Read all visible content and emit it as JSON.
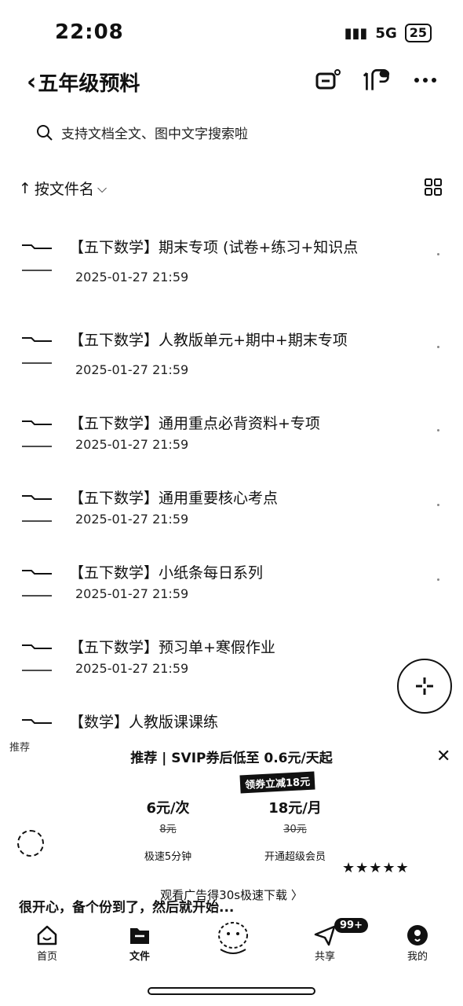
{
  "status_bar": {
    "time": "22:08",
    "network": "5G",
    "battery": "25"
  },
  "nav": {
    "title": "五年级预料"
  },
  "search": {
    "placeholder": "支持文档全文、图中文字搜索啦"
  },
  "sort": {
    "label": "按文件名"
  },
  "files": [
    {
      "name": "【五下数学】期末专项 (试卷+练习+知识点",
      "date": "2025-01-27 21:59"
    },
    {
      "name": "【五下数学】人教版单元+期中+期末专项",
      "date": "2025-01-27 21:59"
    },
    {
      "name": "【五下数学】通用重点必背资料+专项",
      "date": "2025-01-27 21:59"
    },
    {
      "name": "【五下数学】通用重要核心考点",
      "date": "2025-01-27 21:59"
    },
    {
      "name": "【五下数学】小纸条每日系列",
      "date": "2025-01-27 21:59"
    },
    {
      "name": "【五下数学】预习单+寒假作业",
      "date": "2025-01-27 21:59"
    },
    {
      "name": "【数学】人教版课课练",
      "date": ""
    }
  ],
  "promo": {
    "tag": "推荐",
    "title": "推荐 | SVIP券后低至 0.6元/天起",
    "badge": "领券立减18元",
    "plans": [
      {
        "price": "6元/次",
        "old": "8元",
        "desc": "极速5分钟"
      },
      {
        "price": "18元/月",
        "old": "30元",
        "desc": "开通超级会员"
      }
    ],
    "stars": "★★★★★",
    "ad_text": "观看广告得30s极速下载 〉",
    "scroll_text": "很开心，备个份到了，然后就开始..."
  },
  "tabs": [
    {
      "label": "首页",
      "icon": "home-icon"
    },
    {
      "label": "文件",
      "icon": "folder-icon"
    },
    {
      "label": "",
      "icon": "mascot-icon"
    },
    {
      "label": "共享",
      "icon": "share-icon"
    },
    {
      "label": "我的",
      "icon": "profile-icon"
    }
  ],
  "share_badge": "99+"
}
